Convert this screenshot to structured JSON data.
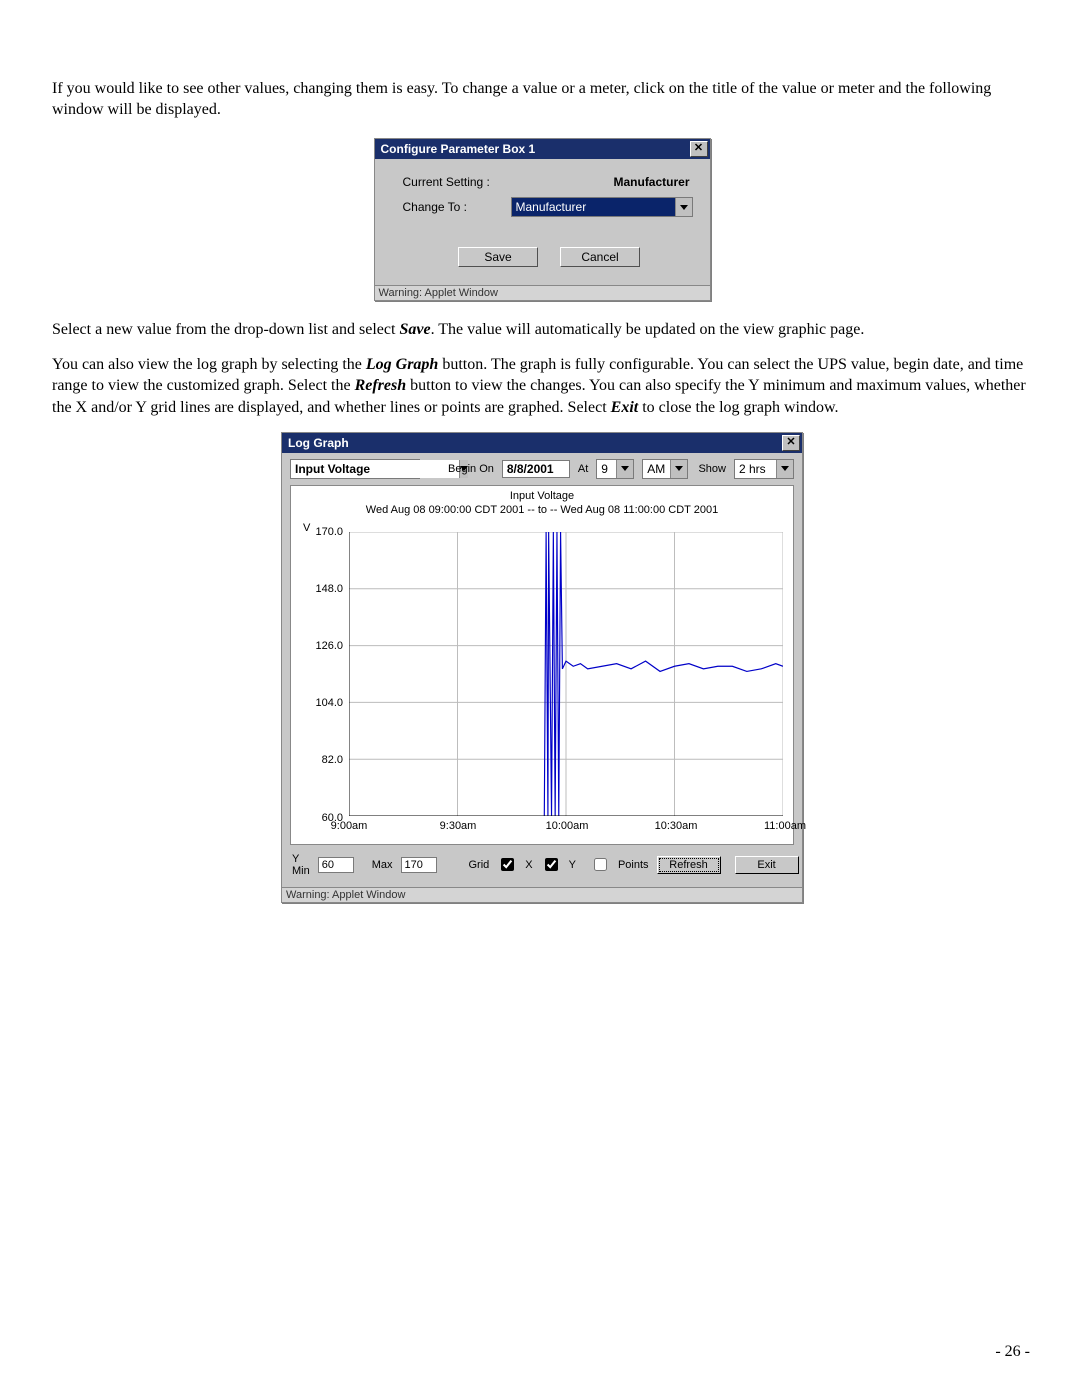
{
  "doc": {
    "p1": "If you would like to see other values, changing them is easy.  To change a value or a meter, click on the title of the value or meter and the following window will be displayed.",
    "p2_a": "Select a new value from the drop-down list and select ",
    "p2_b": "Save",
    "p2_c": ".  The value will automatically be updated on the view graphic page.",
    "p3_a": "You can also view the log graph by selecting the ",
    "p3_b": "Log Graph",
    "p3_c": " button.  The graph is fully configurable.  You can select the UPS value, begin date, and time range to view the customized graph.  Select the ",
    "p3_d": "Refresh",
    "p3_e": " button to view the changes.  You can also specify the Y minimum and maximum values, whether the X and/or Y grid lines are displayed, and whether lines or points are graphed.  Select ",
    "p3_f": "Exit",
    "p3_g": " to close the log graph window.",
    "page_no": "- 26 -"
  },
  "dlg1": {
    "title": "Configure Parameter Box 1",
    "current_label": "Current Setting :",
    "current_value": "Manufacturer",
    "change_label": "Change To :",
    "change_value": "Manufacturer",
    "save": "Save",
    "cancel": "Cancel",
    "status": "Warning: Applet Window"
  },
  "dlg2": {
    "title": "Log Graph",
    "param_value": "Input Voltage",
    "begin_label": "Begin On",
    "begin_value": "8/8/2001",
    "at_label": "At",
    "hour_value": "9",
    "ampm_value": "AM",
    "show_label": "Show",
    "show_value": "2 hrs",
    "chart_title": "Input Voltage",
    "chart_sub": "Wed Aug 08 09:00:00 CDT 2001 -- to -- Wed Aug 08 11:00:00 CDT 2001",
    "y_unit": "V",
    "ymin_label": "Y Min",
    "ymin_value": "60",
    "ymax_label": "Max",
    "ymax_value": "170",
    "grid_label": "Grid",
    "gridX": "X",
    "gridY": "Y",
    "points_label": "Points",
    "refresh": "Refresh",
    "exit": "Exit",
    "status": "Warning: Applet Window"
  },
  "chart_data": {
    "type": "line",
    "title": "Input Voltage",
    "subtitle": "Wed Aug 08 09:00:00 CDT 2001 -- to -- Wed Aug 08 11:00:00 CDT 2001",
    "xlabel": "",
    "ylabel": "V",
    "ylim": [
      60,
      170
    ],
    "x_ticks": [
      "9:00am",
      "9:30am",
      "10:00am",
      "10:30am",
      "11:00am"
    ],
    "y_ticks": [
      60.0,
      82.0,
      104.0,
      126.0,
      148.0,
      170.0
    ],
    "x_minutes": [
      0,
      30,
      60,
      90,
      120
    ],
    "series": [
      {
        "name": "Input Voltage",
        "x": [
          54,
          54.5,
          55,
          55.2,
          56,
          56.5,
          57,
          57.5,
          58,
          58.5,
          59,
          60,
          62,
          64,
          66,
          70,
          74,
          78,
          82,
          86,
          90,
          94,
          98,
          102,
          106,
          110,
          114,
          118,
          120
        ],
        "y": [
          60,
          170,
          60,
          170,
          60,
          170,
          60,
          170,
          60,
          170,
          117,
          120,
          118,
          119,
          117,
          118,
          119,
          117,
          120,
          116,
          118,
          119,
          117,
          118,
          118,
          116,
          117,
          119,
          118
        ]
      }
    ],
    "grid": {
      "x": true,
      "y": true
    }
  }
}
